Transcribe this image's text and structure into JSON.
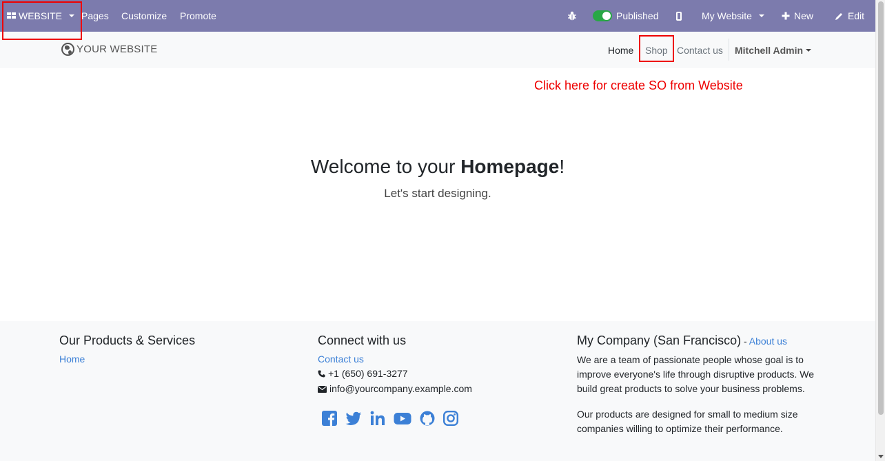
{
  "adminbar": {
    "website_label": "WEBSITE",
    "menu": [
      "Pages",
      "Customize",
      "Promote"
    ],
    "published_label": "Published",
    "my_website_label": "My Website",
    "new_label": "New",
    "edit_label": "Edit"
  },
  "header": {
    "logo_text": "YOUR WEBSITE",
    "nav": [
      "Home",
      "Shop",
      "Contact us"
    ],
    "user": "Mitchell Admin"
  },
  "annotation": "Click here for create SO from Website",
  "hero": {
    "title_prefix": "Welcome to your ",
    "title_bold": "Homepage",
    "title_suffix": "!",
    "subtitle": "Let's start designing."
  },
  "footer": {
    "col1": {
      "title": "Our Products & Services",
      "link": "Home"
    },
    "col2": {
      "title": "Connect with us",
      "link": "Contact us",
      "phone": "+1 (650) 691-3277",
      "email": "info@yourcompany.example.com",
      "social": [
        "facebook-icon",
        "twitter-icon",
        "linkedin-icon",
        "youtube-icon",
        "github-icon",
        "instagram-icon"
      ]
    },
    "col3": {
      "title": "My Company (San Francisco)",
      "title_sep": " - ",
      "link": "About us",
      "para1": "We are a team of passionate people whose goal is to improve everyone's life through disruptive products. We build great products to solve your business problems.",
      "para2": "Our products are designed for small to medium size companies willing to optimize their performance."
    }
  },
  "colors": {
    "adminbar_bg": "#7c7bad",
    "published_toggle": "#28a745",
    "link": "#3c80d6",
    "annotation": "#ee0000"
  }
}
